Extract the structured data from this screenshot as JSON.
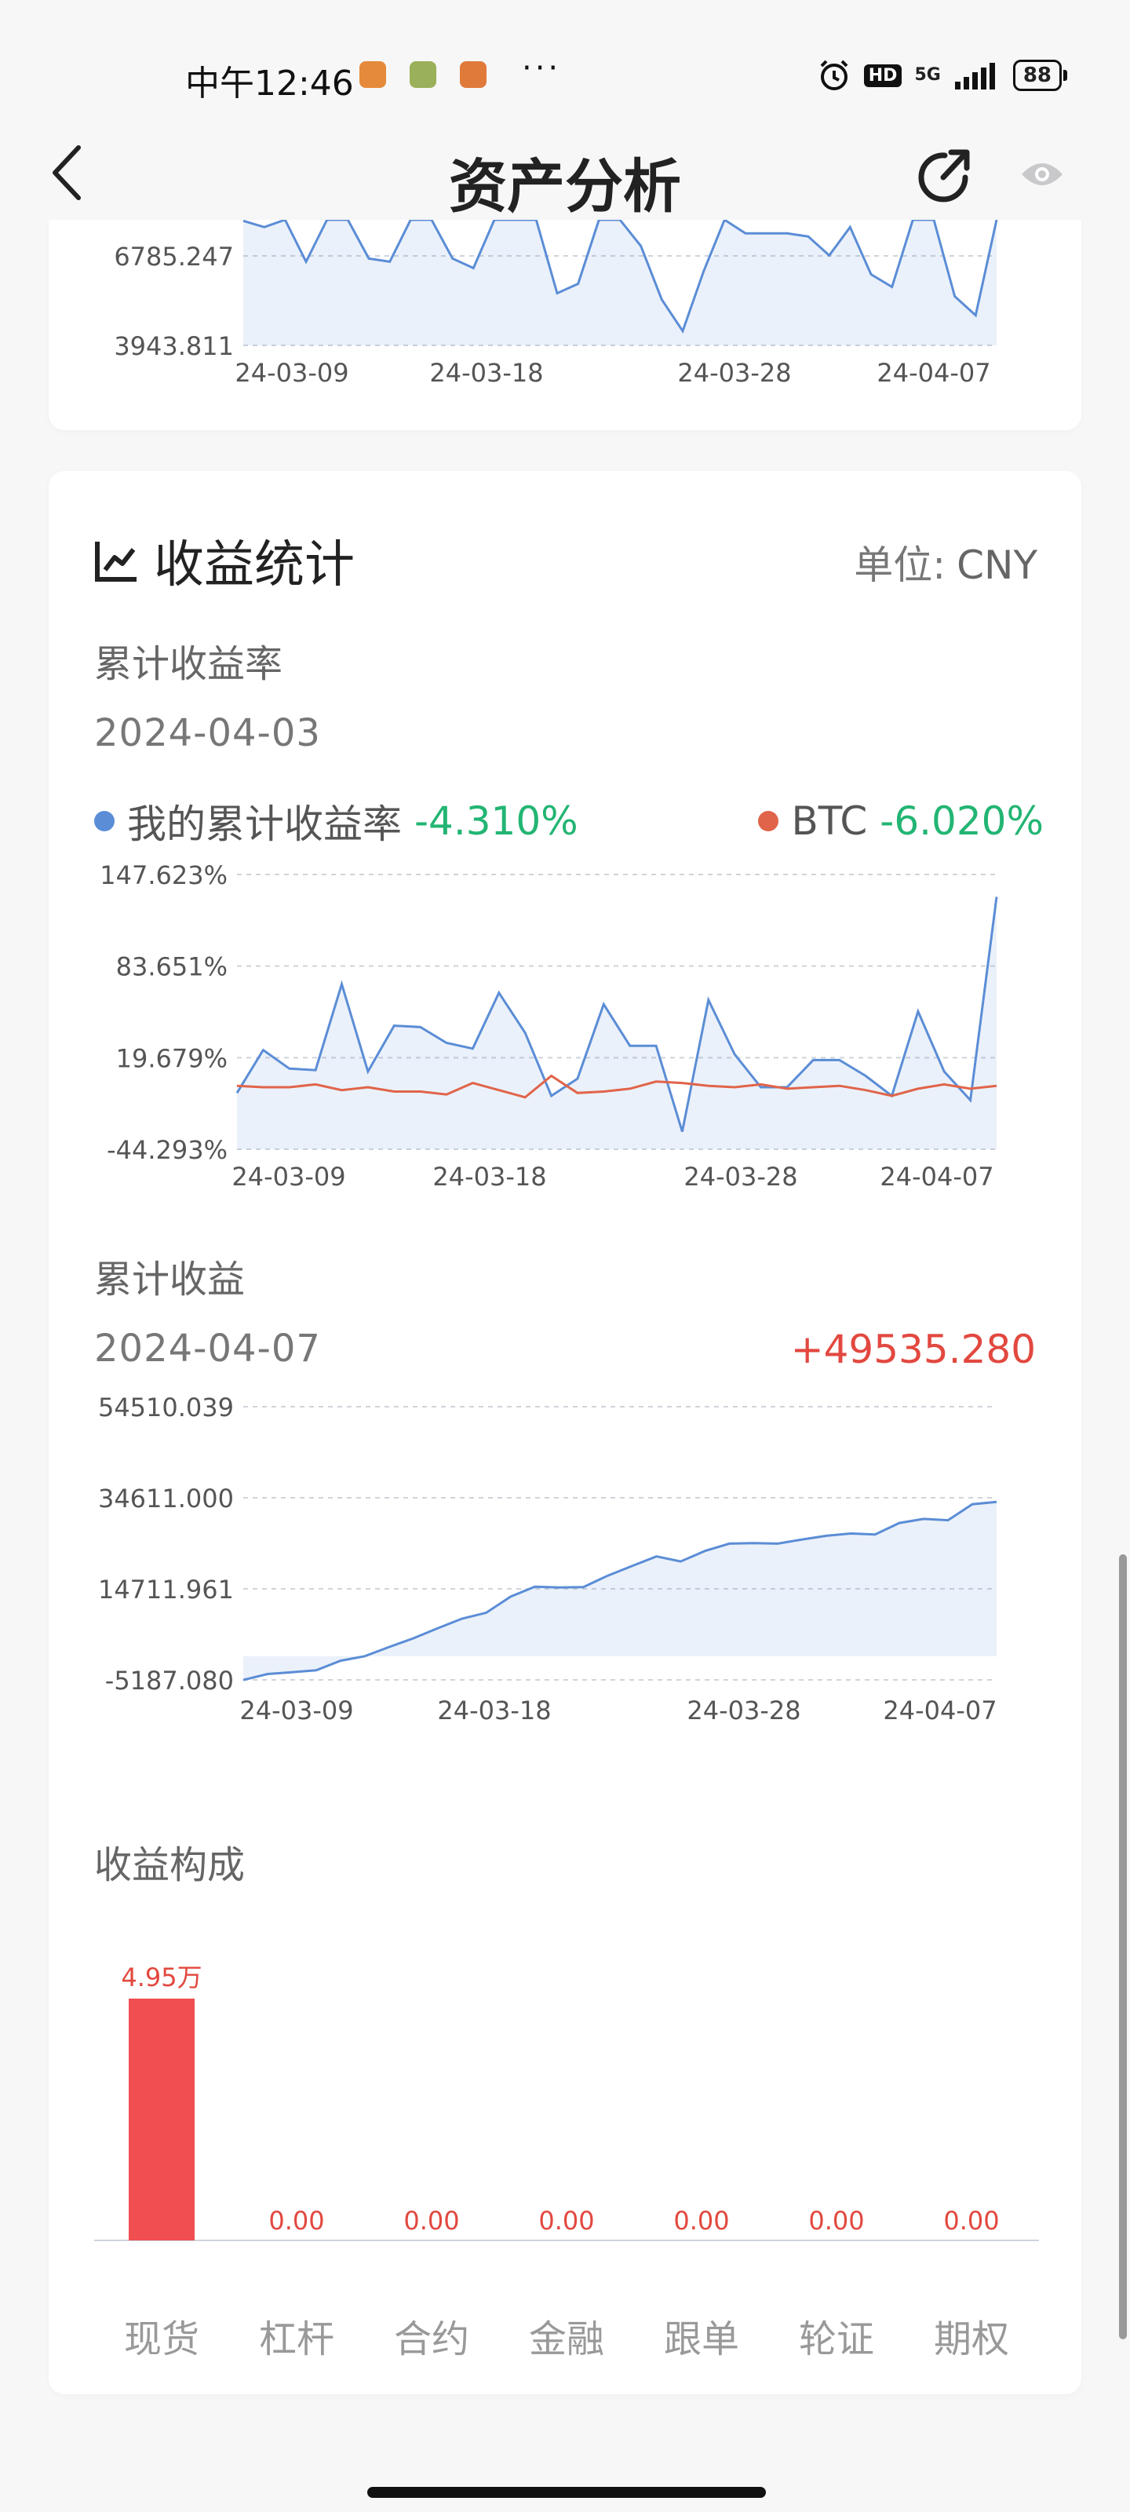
{
  "status_bar": {
    "time": "中午12:46",
    "more": "···",
    "hd": "HD",
    "network": "5G",
    "battery": "88"
  },
  "header": {
    "title": "资产分析",
    "back_icon": "chevron-left-icon",
    "share_icon": "share-arrow-icon",
    "visibility_icon": "eye-icon"
  },
  "asset_chart": {
    "y_ticks": [
      "6785.247",
      "3943.811"
    ],
    "x_ticks": [
      "24-03-09",
      "24-03-18",
      "24-03-28",
      "24-04-07"
    ]
  },
  "income_stats": {
    "title": "收益统计",
    "unit_label": "单位:",
    "unit_value": "CNY",
    "cum_rate": {
      "label": "累计收益率",
      "date": "2024-04-03",
      "my_label": "我的累计收益率",
      "my_value": "-4.310%",
      "btc_label": "BTC",
      "btc_value": "-6.020%"
    },
    "cum_gain": {
      "label": "累计收益",
      "date": "2024-04-07",
      "value": "+49535.280"
    },
    "composition": {
      "label": "收益构成"
    }
  },
  "colors": {
    "blue": "#5b8dd6",
    "red": "#e0644a",
    "green": "#22b573",
    "bar_red": "#f04e50"
  },
  "chart_data": [
    {
      "type": "line",
      "name": "asset-chart",
      "x_ticks": [
        "24-03-09",
        "24-03-18",
        "24-03-28",
        "24-04-07"
      ],
      "y_ticks": [
        6785.247,
        3943.811
      ],
      "ylim": [
        3943.811,
        8000
      ],
      "series": [
        {
          "values": [
            7900,
            7700,
            8500,
            6600,
            8300,
            8000,
            6700,
            6600,
            8800,
            8600,
            6700,
            6400,
            8200,
            8500,
            8300,
            5600,
            5900,
            8600,
            8500,
            7100,
            5400,
            4400,
            6300,
            8300,
            7500,
            7500,
            7500,
            7400,
            6800,
            7700,
            6200,
            5800,
            8800,
            8700,
            5500,
            4900,
            8800
          ]
        }
      ]
    },
    {
      "type": "line",
      "name": "cumulative-return-rate",
      "title": "累计收益率",
      "x_ticks": [
        "24-03-09",
        "24-03-18",
        "24-03-28",
        "24-04-07"
      ],
      "y_ticks": [
        147.623,
        83.651,
        19.679,
        -44.293
      ],
      "ylim": [
        -44.293,
        147.623
      ],
      "series": [
        {
          "name": "我的累计收益率",
          "values": [
            -5,
            25,
            12,
            11,
            71,
            10,
            42,
            41,
            30,
            26,
            65,
            37,
            -7,
            5,
            57,
            28,
            28,
            -32,
            60,
            22,
            -1,
            -1,
            18,
            18,
            7,
            -7,
            52,
            10,
            -10,
            132
          ]
        },
        {
          "name": "BTC",
          "values": [
            0,
            -1,
            -1,
            1,
            -3,
            -1,
            -4,
            -4,
            -6,
            2,
            -3,
            -8,
            7,
            -5,
            -4,
            -2,
            3,
            2,
            0,
            -1,
            1,
            -2,
            -1,
            0,
            -3,
            -7,
            -2,
            1,
            -2,
            0
          ]
        }
      ]
    },
    {
      "type": "area",
      "name": "cumulative-gain",
      "title": "累计收益",
      "x_ticks": [
        "24-03-09",
        "24-03-18",
        "24-03-28",
        "24-04-07"
      ],
      "y_ticks": [
        54510.039,
        34611.0,
        14711.961,
        -5187.08
      ],
      "ylim": [
        -5187.08,
        54510.039
      ],
      "series": [
        {
          "values": [
            -5200,
            -3900,
            -3500,
            -3100,
            -1000,
            0,
            2000,
            3900,
            6100,
            8200,
            9500,
            13000,
            15200,
            15000,
            15100,
            17600,
            19700,
            21800,
            20700,
            23000,
            24600,
            24700,
            24600,
            25500,
            26300,
            26800,
            26600,
            29100,
            30000,
            29700,
            33200,
            33700
          ]
        }
      ]
    },
    {
      "type": "bar",
      "name": "income-composition",
      "title": "收益构成",
      "categories": [
        "现货",
        "杠杆",
        "合约",
        "金融",
        "跟单",
        "轮证",
        "期权"
      ],
      "values": [
        49535.28,
        0,
        0,
        0,
        0,
        0,
        0
      ],
      "value_labels": [
        "4.95万",
        "0.00",
        "0.00",
        "0.00",
        "0.00",
        "0.00",
        "0.00"
      ]
    }
  ]
}
